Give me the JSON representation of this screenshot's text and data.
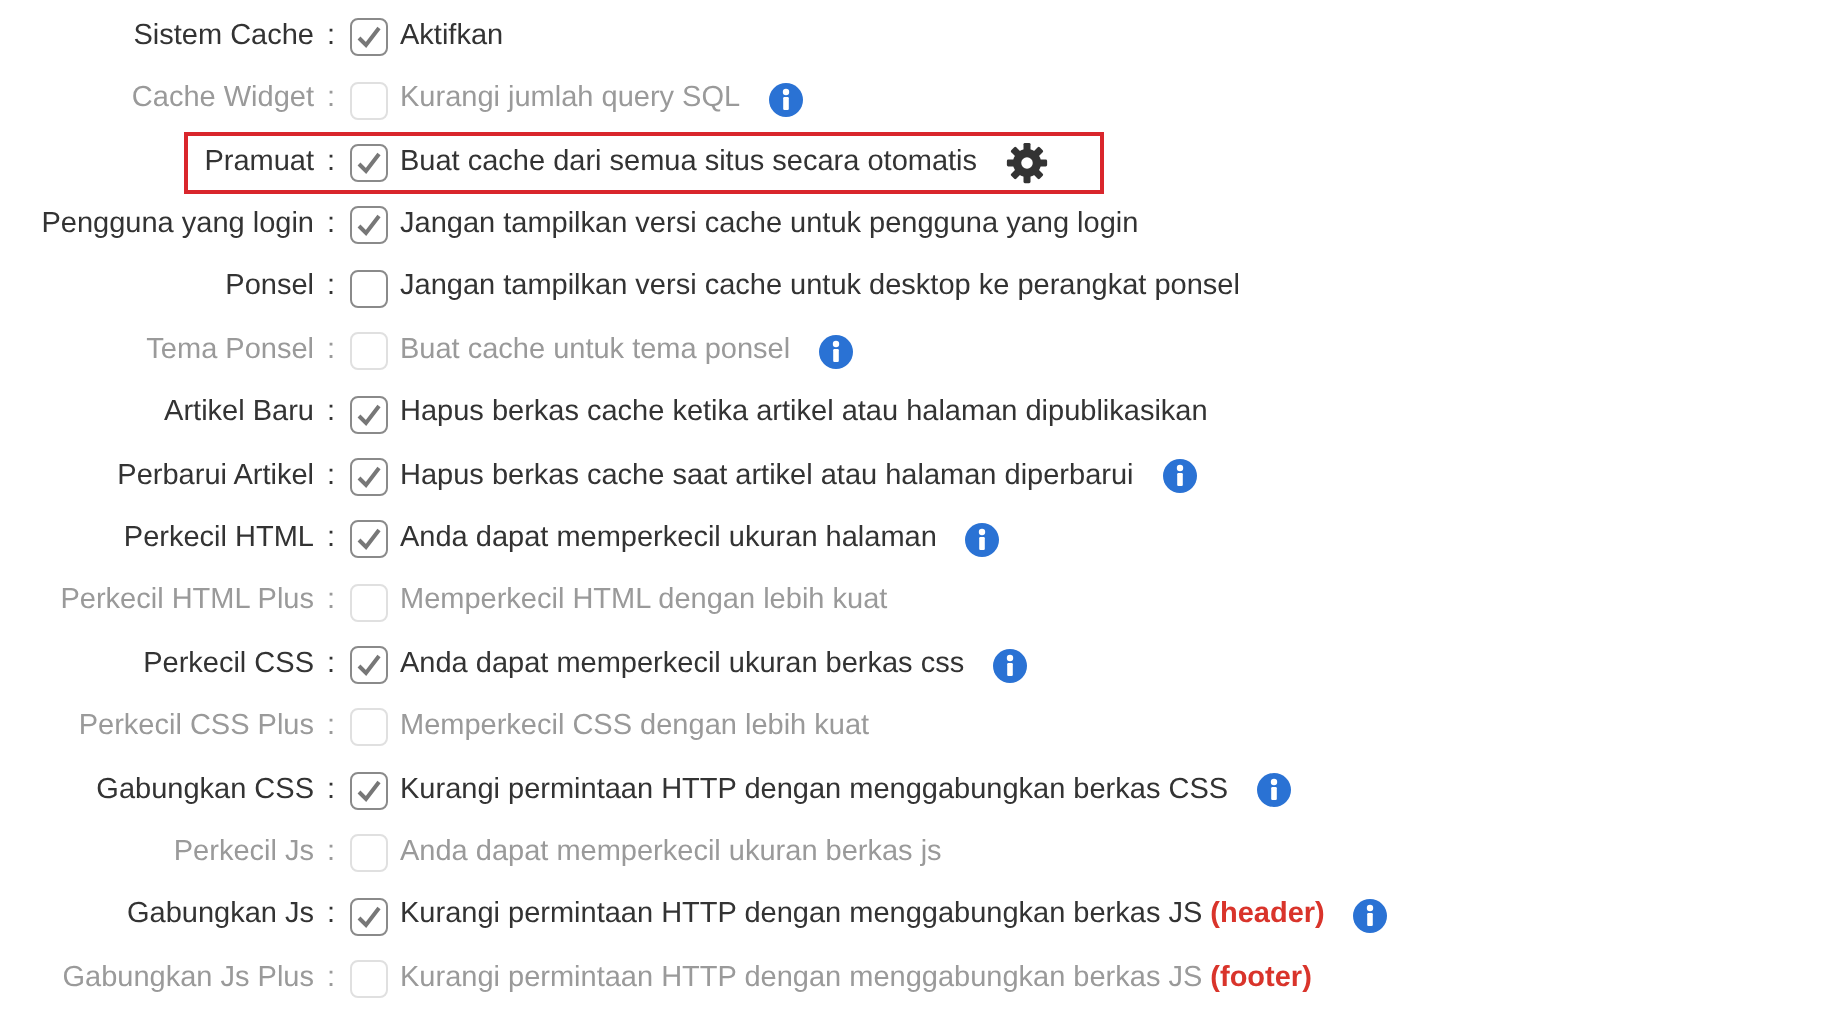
{
  "settings": [
    {
      "label": "Sistem Cache",
      "colon": ":",
      "checked": true,
      "disabled": false,
      "description": "Aktifkan",
      "kind": "plain",
      "highlighted": false
    },
    {
      "label": "Cache Widget",
      "colon": ":",
      "checked": false,
      "disabled": true,
      "description": "Kurangi jumlah query SQL",
      "kind": "info",
      "highlighted": false
    },
    {
      "label": "Pramuat",
      "colon": ":",
      "checked": true,
      "disabled": false,
      "description": "Buat cache dari semua situs secara otomatis",
      "kind": "configurable",
      "highlighted": true
    },
    {
      "label": "Pengguna yang login",
      "colon": ":",
      "checked": true,
      "disabled": false,
      "description": "Jangan tampilkan versi cache untuk pengguna yang login",
      "kind": "plain",
      "highlighted": false
    },
    {
      "label": "Ponsel",
      "colon": ":",
      "checked": false,
      "disabled": false,
      "description": "Jangan tampilkan versi cache untuk desktop ke perangkat ponsel",
      "kind": "plain",
      "highlighted": false
    },
    {
      "label": "Tema Ponsel",
      "colon": ":",
      "checked": false,
      "disabled": true,
      "description": "Buat cache untuk tema ponsel",
      "kind": "info",
      "highlighted": false
    },
    {
      "label": "Artikel Baru",
      "colon": ":",
      "checked": true,
      "disabled": false,
      "description": "Hapus berkas cache ketika artikel atau halaman dipublikasikan",
      "kind": "plain",
      "highlighted": false
    },
    {
      "label": "Perbarui Artikel",
      "colon": ":",
      "checked": true,
      "disabled": false,
      "description": "Hapus berkas cache saat artikel atau halaman diperbarui",
      "kind": "info",
      "highlighted": false
    },
    {
      "label": "Perkecil HTML",
      "colon": ":",
      "checked": true,
      "disabled": false,
      "description": "Anda dapat memperkecil ukuran halaman",
      "kind": "info",
      "highlighted": false
    },
    {
      "label": "Perkecil HTML Plus",
      "colon": ":",
      "checked": false,
      "disabled": true,
      "description": "Memperkecil HTML dengan lebih kuat",
      "kind": "plain",
      "highlighted": false
    },
    {
      "label": "Perkecil CSS",
      "colon": ":",
      "checked": true,
      "disabled": false,
      "description": "Anda dapat memperkecil ukuran berkas css",
      "kind": "info",
      "highlighted": false
    },
    {
      "label": "Perkecil CSS Plus",
      "colon": ":",
      "checked": false,
      "disabled": true,
      "description": "Memperkecil CSS dengan lebih kuat",
      "kind": "plain",
      "highlighted": false
    },
    {
      "label": "Gabungkan CSS",
      "colon": ":",
      "checked": true,
      "disabled": false,
      "description": "Kurangi permintaan HTTP dengan menggabungkan berkas CSS",
      "kind": "info",
      "highlighted": false
    },
    {
      "label": "Perkecil Js",
      "colon": ":",
      "checked": false,
      "disabled": true,
      "description": "Anda dapat memperkecil ukuran berkas js",
      "kind": "plain",
      "highlighted": false
    },
    {
      "label": "Gabungkan Js",
      "colon": ":",
      "checked": true,
      "disabled": false,
      "description": "Kurangi permintaan HTTP dengan menggabungkan berkas JS",
      "tag": "(header)",
      "kind": "info",
      "highlighted": false
    },
    {
      "label": "Gabungkan Js Plus",
      "colon": ":",
      "checked": false,
      "disabled": true,
      "description": "Kurangi permintaan HTTP dengan menggabungkan berkas JS",
      "tag": "(footer)",
      "kind": "plain",
      "highlighted": false
    }
  ]
}
